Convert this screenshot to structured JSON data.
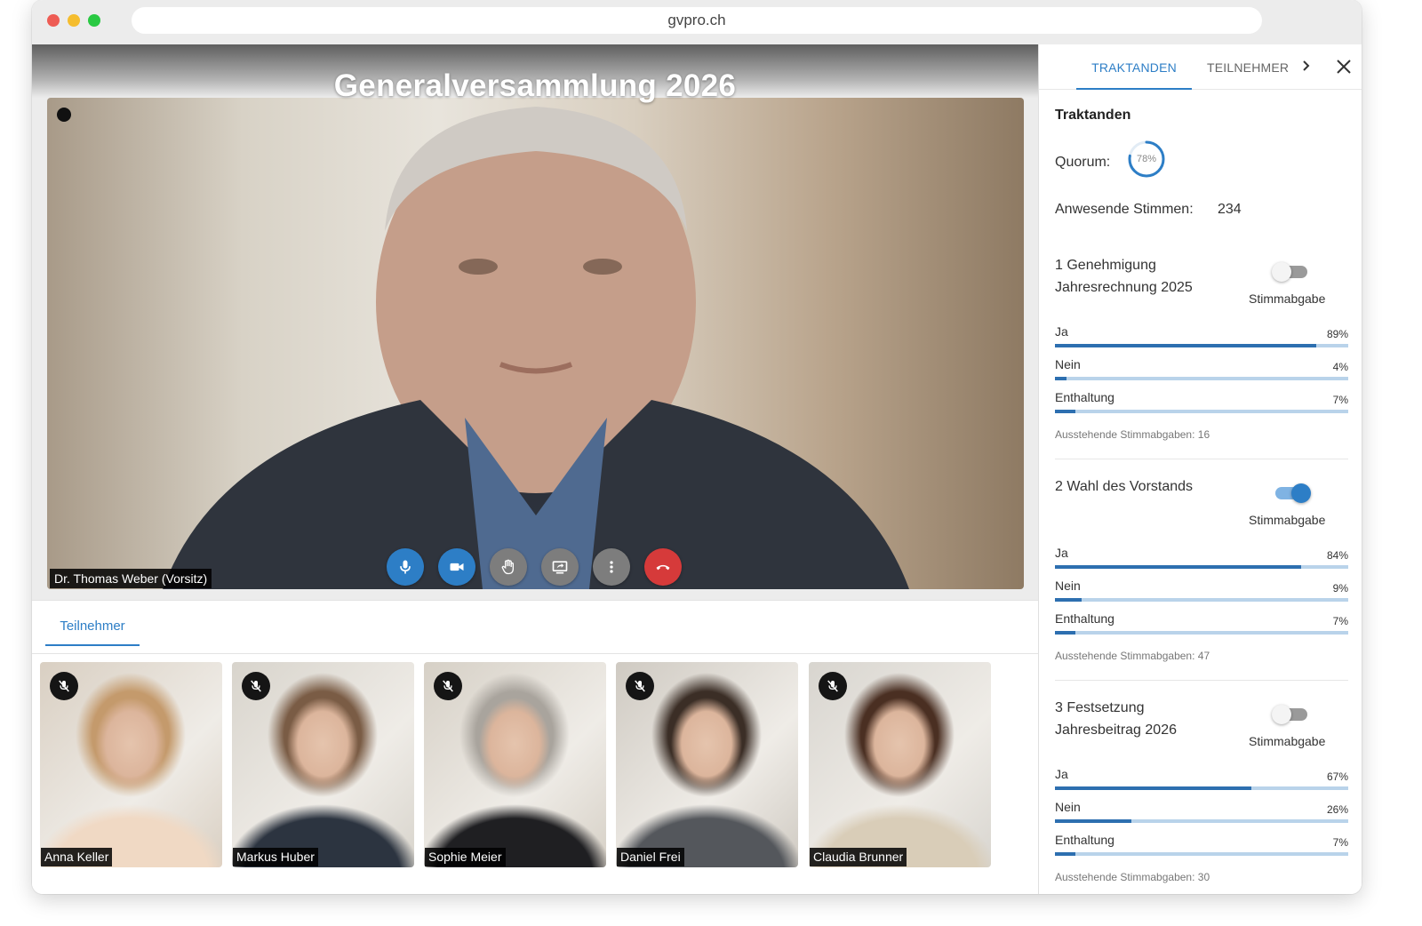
{
  "browser": {
    "url": "gvpro.ch"
  },
  "meeting": {
    "title": "Generalversammlung 2026",
    "speaker": "Dr. Thomas Weber (Vorsitz)",
    "controls": [
      "microphone",
      "camera",
      "raise-hand",
      "share-screen",
      "more",
      "hang-up"
    ]
  },
  "participants_tab": {
    "label": "Teilnehmer"
  },
  "participants": [
    {
      "name": "Anna Keller",
      "muted": true,
      "colors": [
        "#d9cfc2",
        "#c49a6c",
        "#f0d9c4"
      ]
    },
    {
      "name": "Markus Huber",
      "muted": true,
      "colors": [
        "#d8d4cc",
        "#7a5c45",
        "#2c3440"
      ]
    },
    {
      "name": "Sophie Meier",
      "muted": true,
      "colors": [
        "#d6d0c6",
        "#a9a49d",
        "#1f1f22"
      ]
    },
    {
      "name": "Daniel Frei",
      "muted": true,
      "colors": [
        "#cfcac2",
        "#3b2e26",
        "#54575c"
      ]
    },
    {
      "name": "Claudia Brunner",
      "muted": true,
      "colors": [
        "#d8d5cf",
        "#4a2f22",
        "#d9cdb8"
      ]
    }
  ],
  "panel": {
    "tabs": {
      "active": "TRAKTANDEN",
      "second": "TEILNEHMER"
    },
    "title": "Traktanden",
    "quorum_label": "Quorum:",
    "quorum_value": "78%",
    "quorum_fraction": 0.78,
    "votes_label": "Anwesende Stimmen:",
    "votes_value": "234",
    "toggle_label": "Stimmabgabe",
    "items": [
      {
        "title": "1 Genehmigung Jahresrechnung 2025",
        "voting_on": false,
        "options": [
          {
            "label": "Ja",
            "pct_text": "89%",
            "pct": 89
          },
          {
            "label": "Nein",
            "pct_text": "4%",
            "pct": 4
          },
          {
            "label": "Enthaltung",
            "pct_text": "7%",
            "pct": 7
          }
        ],
        "pending": "Ausstehende Stimmabgaben: 16"
      },
      {
        "title": "2 Wahl des Vorstands",
        "voting_on": true,
        "options": [
          {
            "label": "Ja",
            "pct_text": "84%",
            "pct": 84
          },
          {
            "label": "Nein",
            "pct_text": "9%",
            "pct": 9
          },
          {
            "label": "Enthaltung",
            "pct_text": "7%",
            "pct": 7
          }
        ],
        "pending": "Ausstehende Stimmabgaben: 47"
      },
      {
        "title": "3 Festsetzung Jahresbeitrag 2026",
        "voting_on": false,
        "options": [
          {
            "label": "Ja",
            "pct_text": "67%",
            "pct": 67
          },
          {
            "label": "Nein",
            "pct_text": "26%",
            "pct": 26
          },
          {
            "label": "Enthaltung",
            "pct_text": "7%",
            "pct": 7
          }
        ],
        "pending": "Ausstehende Stimmabgaben: 30"
      }
    ]
  }
}
